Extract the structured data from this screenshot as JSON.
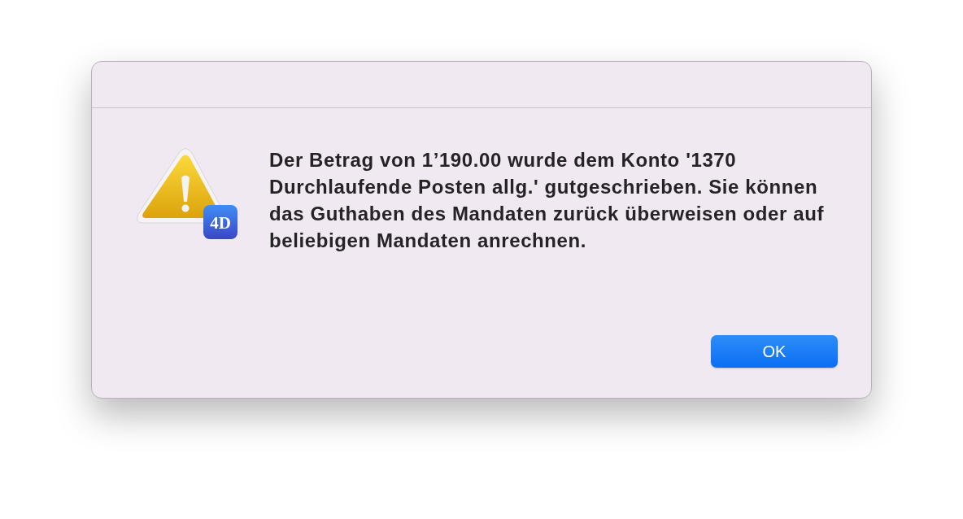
{
  "dialog": {
    "badge": "4D",
    "message": "Der Betrag von 1’190.00 wurde dem Konto '1370 Durchlaufende Posten allg.' gutgeschrieben. Sie können das Guthaben des Mandaten zurück überweisen oder auf beliebigen Mandaten anrechnen.",
    "buttons": [
      "OK"
    ]
  }
}
